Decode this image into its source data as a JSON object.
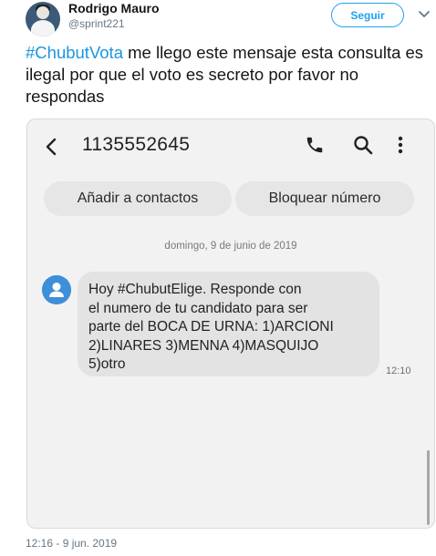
{
  "author": {
    "name": "Rodrigo Mauro",
    "handle": "@sprint221"
  },
  "follow_button": "Seguir",
  "tweet": {
    "hashtag": "#ChubutVota",
    "text": " me llego este mensaje esta consulta es ilegal por que el voto es secreto por favor no respondas"
  },
  "sms_screen": {
    "phone_number": "1135552645",
    "buttons": {
      "add_contact": "Añadir a contactos",
      "block_number": "Bloquear número"
    },
    "date_divider": "domingo, 9 de junio de 2019",
    "message": {
      "text": "Hoy #ChubutElige. Responde con\nel numero de tu candidato para ser\nparte del BOCA DE URNA: 1)ARCIONI\n2)LINARES 3)MENNA 4)MASQUIJO\n5)otro",
      "time": "12:10"
    },
    "icons": [
      "back-arrow-icon",
      "phone-icon",
      "search-icon",
      "more-vertical-icon",
      "contact-avatar-icon"
    ]
  },
  "tweet_timestamp": "12:16 - 9 jun. 2019",
  "colors": {
    "link_blue": "#1da1f2",
    "hashtag_blue": "#1b95e0",
    "contact_icon_blue": "#3d8fd9"
  }
}
